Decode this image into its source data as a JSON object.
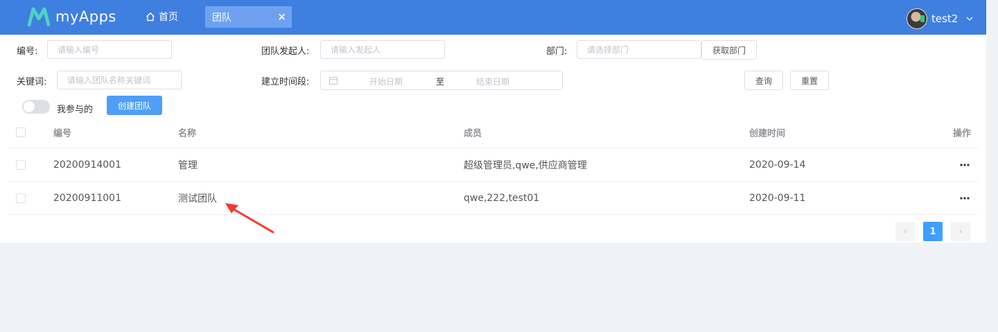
{
  "header": {
    "logo_text": "myApps",
    "home_label": "首页",
    "active_tab": "团队",
    "tab_close": "×",
    "user_name": "test2"
  },
  "filters": {
    "number": {
      "label": "编号:",
      "placeholder": "请输入编号"
    },
    "initiator": {
      "label": "团队发起人:",
      "placeholder": "请输入发起人"
    },
    "department": {
      "label": "部门:",
      "placeholder": "请选择部门",
      "button": "获取部门"
    },
    "keyword": {
      "label": "关键词:",
      "placeholder": "请输入团队名称关键词"
    },
    "period": {
      "label": "建立时间段:",
      "start_placeholder": "开始日期",
      "separator": "至",
      "end_placeholder": "结束日期"
    },
    "query_button": "查询",
    "reset_button": "重置",
    "mine_toggle_label": "我参与的",
    "mine_toggle_on": false,
    "create_button": "创建团队"
  },
  "table": {
    "columns": [
      "编号",
      "名称",
      "成员",
      "创建时间",
      "操作"
    ],
    "rows": [
      {
        "number": "20200914001",
        "name": "管理",
        "members": "超级管理员,qwe,供应商管理",
        "created": "2020-09-14"
      },
      {
        "number": "20200911001",
        "name": "测试团队",
        "members": "qwe,222,test01",
        "created": "2020-09-11"
      }
    ]
  },
  "pagination": {
    "current": "1",
    "prev": "‹",
    "next": "›"
  },
  "colors": {
    "header": "#3f7fe0",
    "primary": "#409eff",
    "annotation_arrow": "#f23a2f"
  }
}
